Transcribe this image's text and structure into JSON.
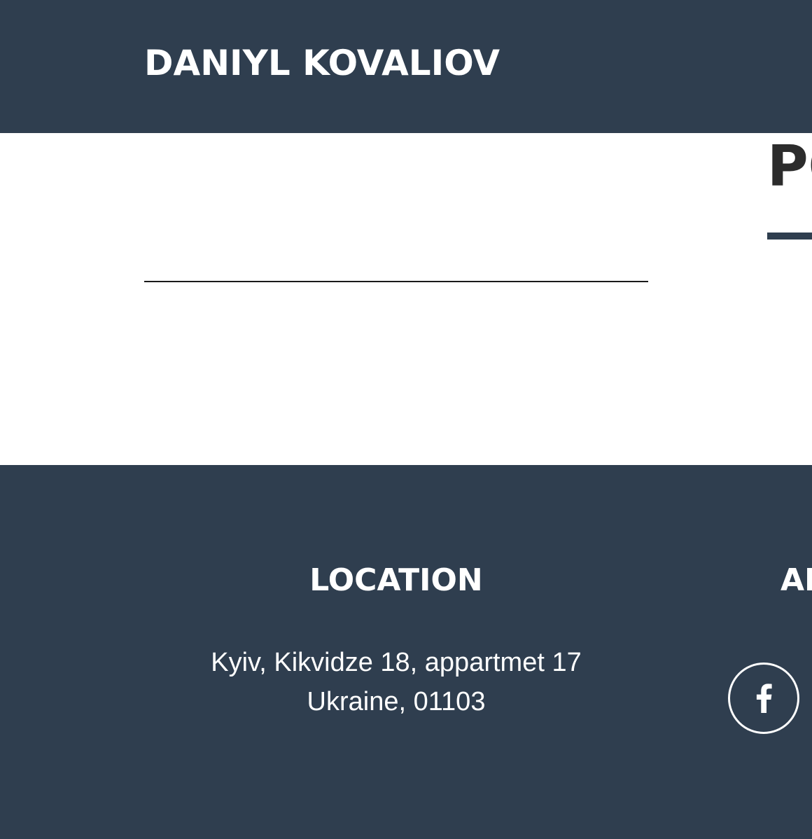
{
  "header": {
    "brand": "DANIYL KOVALIOV"
  },
  "main": {
    "section_title": "PORTFOLIO"
  },
  "footer": {
    "location": {
      "heading": "LOCATION",
      "address_line1": "Kyiv, Kikvidze 18, appartmet 17",
      "address_line2": "Ukraine, 01103"
    },
    "social": {
      "heading": "AROUND THE WEB",
      "icons": [
        "facebook-icon"
      ]
    }
  },
  "colors": {
    "primary": "#2f3e4f",
    "text_light": "#ffffff",
    "text_dark": "#2c2c2c"
  }
}
